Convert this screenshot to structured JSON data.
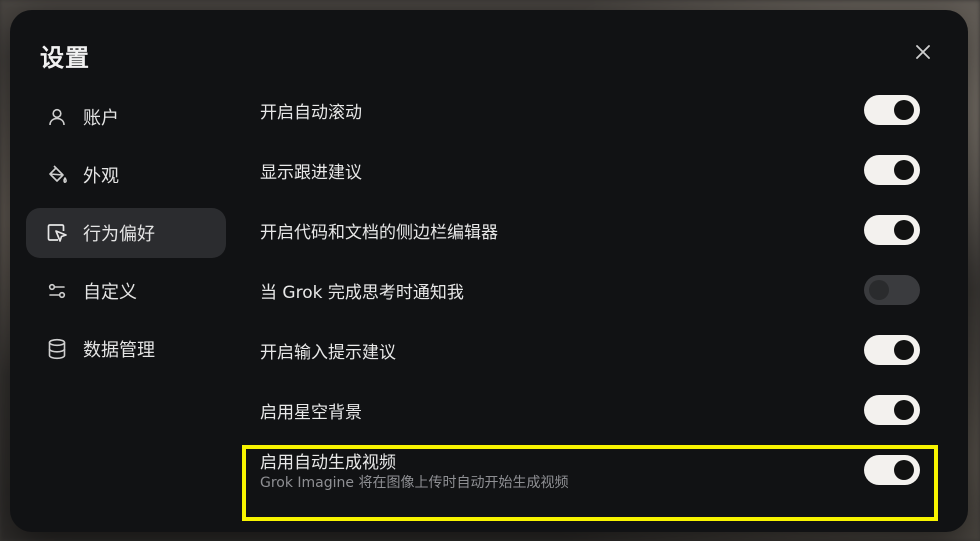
{
  "dialog": {
    "title": "设置",
    "close_icon": "close-icon"
  },
  "nav": {
    "items": [
      {
        "label": "账户",
        "icon": "user-icon",
        "active": false
      },
      {
        "label": "外观",
        "icon": "paint-bucket-icon",
        "active": false
      },
      {
        "label": "行为偏好",
        "icon": "cursor-pointer-icon",
        "active": true
      },
      {
        "label": "自定义",
        "icon": "sliders-icon",
        "active": false
      },
      {
        "label": "数据管理",
        "icon": "database-icon",
        "active": false
      }
    ]
  },
  "settings": {
    "rows": [
      {
        "label": "开启自动滚动",
        "enabled": true
      },
      {
        "label": "显示跟进建议",
        "enabled": true
      },
      {
        "label": "开启代码和文档的侧边栏编辑器",
        "enabled": true
      },
      {
        "label": "当 Grok 完成思考时通知我",
        "enabled": false
      },
      {
        "label": "开启输入提示建议",
        "enabled": true
      },
      {
        "label": "启用星空背景",
        "enabled": true
      },
      {
        "label": "启用自动生成视频",
        "sublabel": "Grok Imagine 将在图像上传时自动开始生成视频",
        "enabled": true
      }
    ]
  },
  "colors": {
    "dialog_bg": "#111214",
    "toggle_on": "#f3f1ee",
    "highlight": "#f8f400"
  }
}
